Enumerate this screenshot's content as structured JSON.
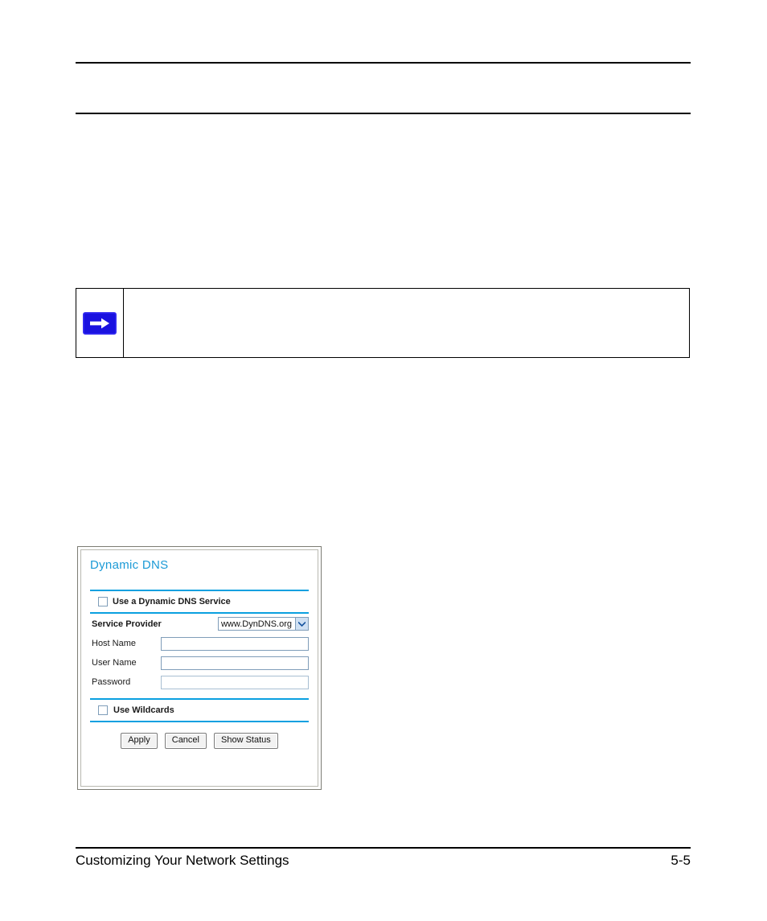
{
  "page": {
    "header_title": "",
    "body_text": "",
    "mid_text": "",
    "note": {
      "icon": "blue-right-arrow-icon",
      "text": ""
    },
    "footer": {
      "chapter_title": "Customizing Your Network Settings",
      "page_number": "5-5"
    }
  },
  "figure": {
    "panel_title": "Dynamic DNS",
    "enable_checkbox": {
      "label": "Use a Dynamic DNS Service",
      "checked": false
    },
    "service_provider": {
      "label": "Service Provider",
      "selected": "www.DynDNS.org",
      "dropdown_icon": "chevron-down-icon"
    },
    "fields": [
      {
        "label": "Host Name",
        "value": "",
        "type": "text"
      },
      {
        "label": "User Name",
        "value": "",
        "type": "text"
      },
      {
        "label": "Password",
        "value": "",
        "type": "password"
      }
    ],
    "wildcards_checkbox": {
      "label": "Use Wildcards",
      "checked": false
    },
    "buttons": [
      {
        "label": "Apply"
      },
      {
        "label": "Cancel"
      },
      {
        "label": "Show Status"
      }
    ]
  },
  "colors": {
    "accent_blue": "#0aa0e0",
    "title_blue": "#1b9ad6",
    "note_arrow_blue": "#1a12e0",
    "field_border": "#7f9db9"
  }
}
